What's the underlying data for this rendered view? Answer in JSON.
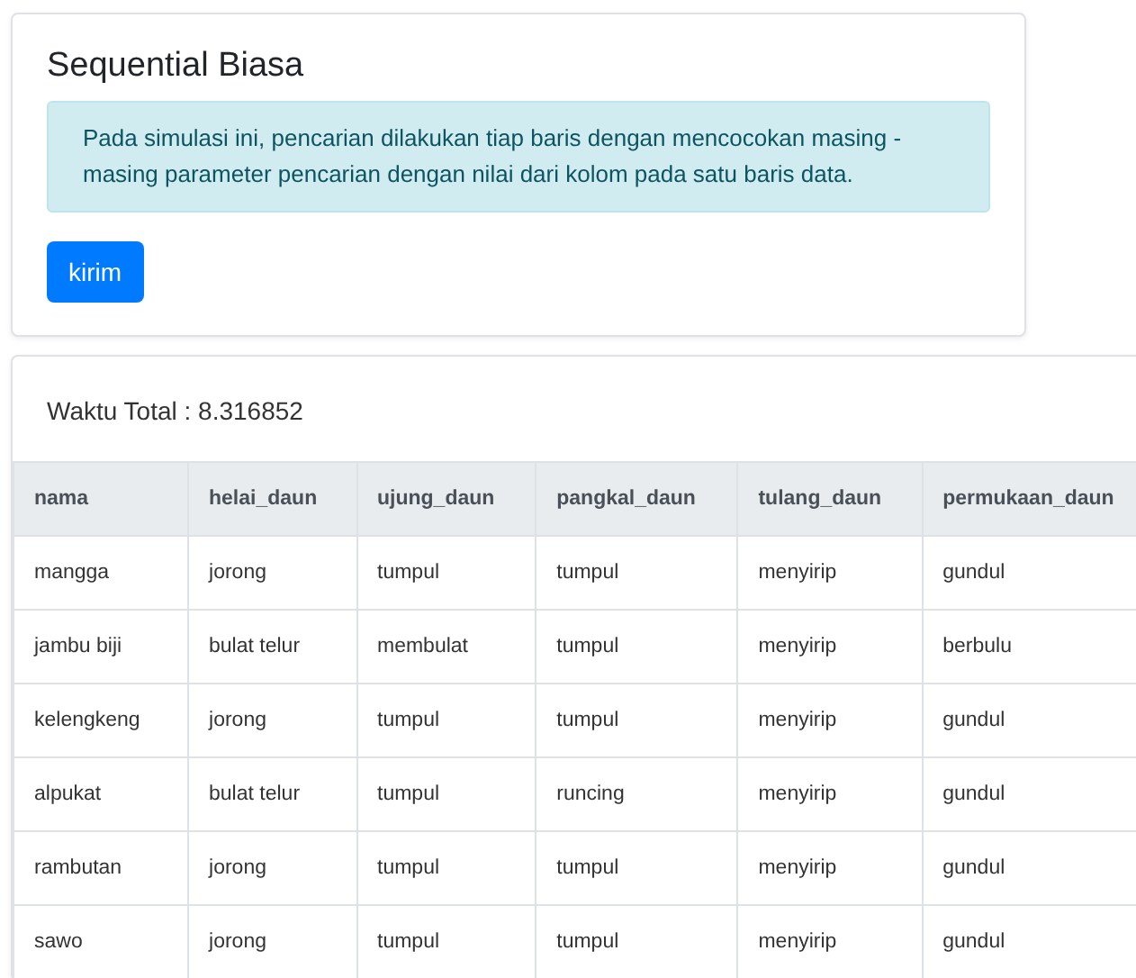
{
  "search_card": {
    "title": "Sequential Biasa",
    "info": "Pada simulasi ini, pencarian dilakukan tiap baris dengan mencocokan masing - masing parameter pencarian dengan nilai dari kolom pada satu baris data.",
    "button": "kirim"
  },
  "result_card": {
    "total_time": "Waktu Total : 8.316852",
    "table": {
      "columns": [
        "nama",
        "helai_daun",
        "ujung_daun",
        "pangkal_daun",
        "tulang_daun",
        "permukaan_daun"
      ],
      "rows": [
        [
          "mangga",
          "jorong",
          "tumpul",
          "tumpul",
          "menyirip",
          "gundul"
        ],
        [
          "jambu biji",
          "bulat telur",
          "membulat",
          "tumpul",
          "menyirip",
          "berbulu"
        ],
        [
          "kelengkeng",
          "jorong",
          "tumpul",
          "tumpul",
          "menyirip",
          "gundul"
        ],
        [
          "alpukat",
          "bulat telur",
          "tumpul",
          "runcing",
          "menyirip",
          "gundul"
        ],
        [
          "rambutan",
          "jorong",
          "tumpul",
          "tumpul",
          "menyirip",
          "gundul"
        ],
        [
          "sawo",
          "jorong",
          "tumpul",
          "tumpul",
          "menyirip",
          "gundul"
        ]
      ]
    }
  }
}
